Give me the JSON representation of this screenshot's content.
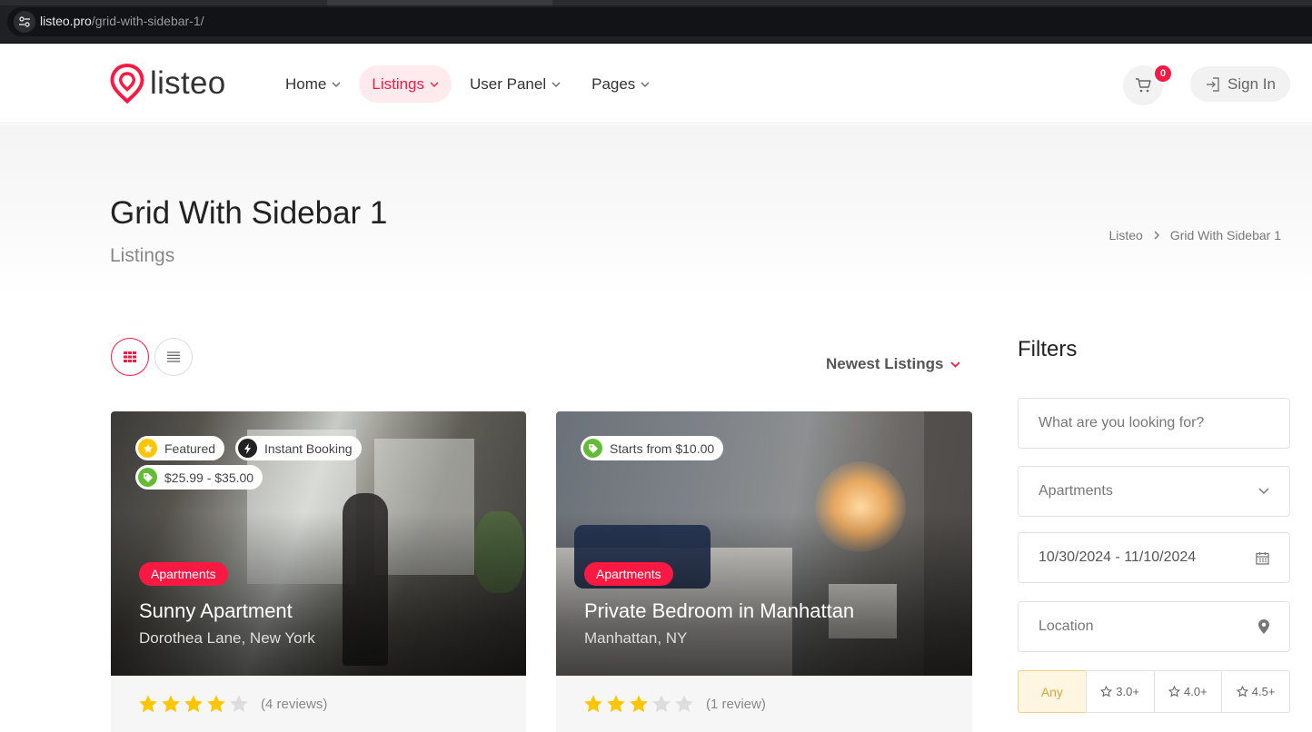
{
  "browser": {
    "url_host": "listeo.pro",
    "url_path": "/grid-with-sidebar-1/"
  },
  "header": {
    "logo_text": "listeo",
    "nav": [
      {
        "label": "Home",
        "active": false
      },
      {
        "label": "Listings",
        "active": true
      },
      {
        "label": "User Panel",
        "active": false
      },
      {
        "label": "Pages",
        "active": false
      }
    ],
    "cart_count": "0",
    "signin_label": "Sign In"
  },
  "page": {
    "title": "Grid With Sidebar 1",
    "subtitle": "Listings",
    "breadcrumb": [
      "Listeo",
      "Grid With Sidebar 1"
    ]
  },
  "toolbar": {
    "sort_label": "Newest Listings"
  },
  "listings": [
    {
      "badges": {
        "featured": "Featured",
        "instant": "Instant Booking",
        "price": "$25.99 - $35.00"
      },
      "category": "Apartments",
      "title": "Sunny Apartment",
      "location": "Dorothea Lane, New York",
      "rating": 4,
      "reviews": "(4 reviews)"
    },
    {
      "badges": {
        "price": "Starts from $10.00"
      },
      "category": "Apartments",
      "title": "Private Bedroom in Manhattan",
      "location": "Manhattan, NY",
      "rating": 3,
      "reviews": "(1 review)"
    }
  ],
  "filters": {
    "title": "Filters",
    "search_placeholder": "What are you looking for?",
    "category_value": "Apartments",
    "date_value": "10/30/2024 - 11/10/2024",
    "location_placeholder": "Location",
    "rating_options": [
      "Any",
      "3.0+",
      "4.0+",
      "4.5+"
    ]
  },
  "colors": {
    "accent": "#f91942",
    "star": "#ffc600",
    "star_empty": "#dddddd"
  }
}
